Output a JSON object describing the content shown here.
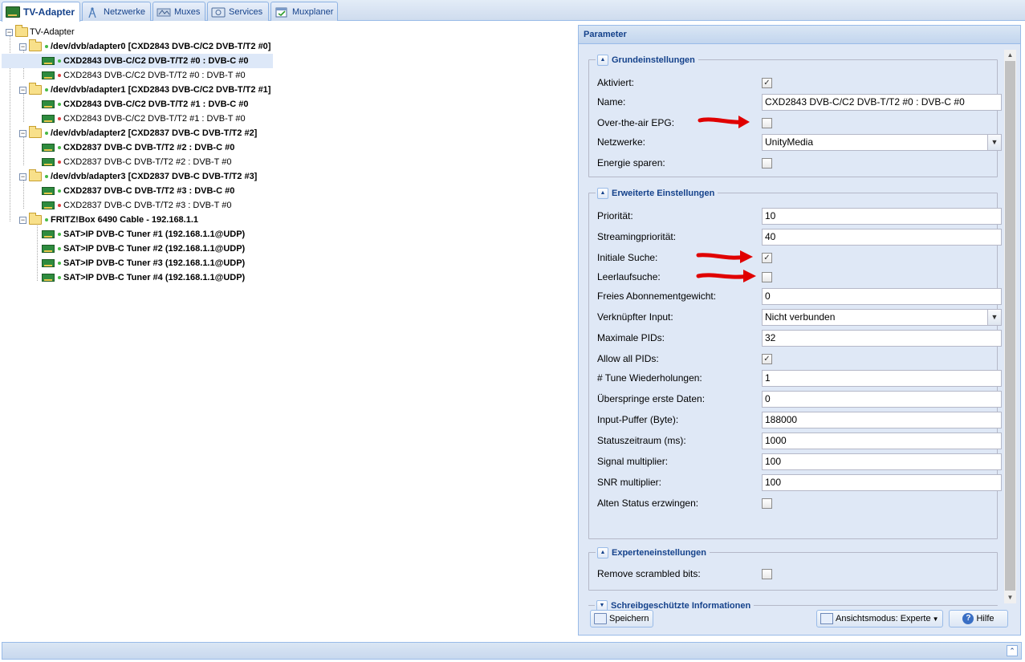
{
  "tabs": [
    {
      "label": "TV-Adapter",
      "icon": "tv-card-icon",
      "active": true
    },
    {
      "label": "Netzwerke",
      "icon": "antenna-icon",
      "active": false
    },
    {
      "label": "Muxes",
      "icon": "mux-icon",
      "active": false
    },
    {
      "label": "Services",
      "icon": "services-icon",
      "active": false
    },
    {
      "label": "Muxplaner",
      "icon": "calendar-check-icon",
      "active": false
    }
  ],
  "tree": {
    "root": "TV-Adapter",
    "adapter0": "/dev/dvb/adapter0 [CXD2843 DVB-C/C2 DVB-T/T2 #0]",
    "a0_c": "CXD2843 DVB-C/C2 DVB-T/T2 #0 : DVB-C #0",
    "a0_t": "CXD2843 DVB-C/C2 DVB-T/T2 #0 : DVB-T #0",
    "adapter1": "/dev/dvb/adapter1 [CXD2843 DVB-C/C2 DVB-T/T2 #1]",
    "a1_c": "CXD2843 DVB-C/C2 DVB-T/T2 #1 : DVB-C #0",
    "a1_t": "CXD2843 DVB-C/C2 DVB-T/T2 #1 : DVB-T #0",
    "adapter2": "/dev/dvb/adapter2 [CXD2837 DVB-C DVB-T/T2 #2]",
    "a2_c": "CXD2837 DVB-C DVB-T/T2 #2 : DVB-C #0",
    "a2_t": "CXD2837 DVB-C DVB-T/T2 #2 : DVB-T #0",
    "adapter3": "/dev/dvb/adapter3 [CXD2837 DVB-C DVB-T/T2 #3]",
    "a3_c": "CXD2837 DVB-C DVB-T/T2 #3 : DVB-C #0",
    "a3_t": "CXD2837 DVB-C DVB-T/T2 #3 : DVB-T #0",
    "fritz": "FRITZ!Box 6490 Cable - 192.168.1.1",
    "sat1": "SAT>IP DVB-C Tuner #1 (192.168.1.1@UDP)",
    "sat2": "SAT>IP DVB-C Tuner #2 (192.168.1.1@UDP)",
    "sat3": "SAT>IP DVB-C Tuner #3 (192.168.1.1@UDP)",
    "sat4": "SAT>IP DVB-C Tuner #4 (192.168.1.1@UDP)"
  },
  "param": {
    "title": "Parameter",
    "basic": {
      "legend": "Grundeinstellungen",
      "enabled_label": "Aktiviert:",
      "enabled": true,
      "name_label": "Name:",
      "name_value": "CXD2843 DVB-C/C2 DVB-T/T2 #0 : DVB-C #0",
      "epg_label": "Over-the-air EPG:",
      "epg": false,
      "networks_label": "Netzwerke:",
      "networks_value": "UnityMedia",
      "power_label": "Energie sparen:",
      "power": false
    },
    "advanced": {
      "legend": "Erweiterte Einstellungen",
      "priority_label": "Priorität:",
      "priority": "10",
      "stream_prio_label": "Streamingpriorität:",
      "stream_prio": "40",
      "initial_scan_label": "Initiale Suche:",
      "initial_scan": true,
      "idle_scan_label": "Leerlaufsuche:",
      "idle_scan": false,
      "sub_weight_label": "Freies Abonnementgewicht:",
      "sub_weight": "0",
      "linked_label": "Verknüpfter Input:",
      "linked_value": "Nicht verbunden",
      "max_pids_label": "Maximale PIDs:",
      "max_pids": "32",
      "allow_pids_label": "Allow all PIDs:",
      "allow_pids": true,
      "tune_rep_label": "# Tune Wiederholungen:",
      "tune_rep": "1",
      "skip_label": "Überspringe erste Daten:",
      "skip": "0",
      "buffer_label": "Input-Puffer (Byte):",
      "buffer": "188000",
      "status_label": "Statuszeitraum (ms):",
      "status": "1000",
      "signal_label": "Signal multiplier:",
      "signal": "100",
      "snr_label": "SNR multiplier:",
      "snr": "100",
      "old_status_label": "Alten Status erzwingen:",
      "old_status": false
    },
    "expert": {
      "legend": "Experteneinstellungen",
      "scrambled_label": "Remove scrambled bits:",
      "scrambled": false
    },
    "readonly": {
      "legend": "Schreibgeschützte Informationen"
    },
    "buttons": {
      "save": "Speichern",
      "view_mode": "Ansichtsmodus: Experte",
      "help": "Hilfe"
    }
  },
  "colors": {
    "accent": "#15428b",
    "panel_bg": "#dfe8f6",
    "border": "#99bbe8",
    "annotation": "#e00000"
  }
}
